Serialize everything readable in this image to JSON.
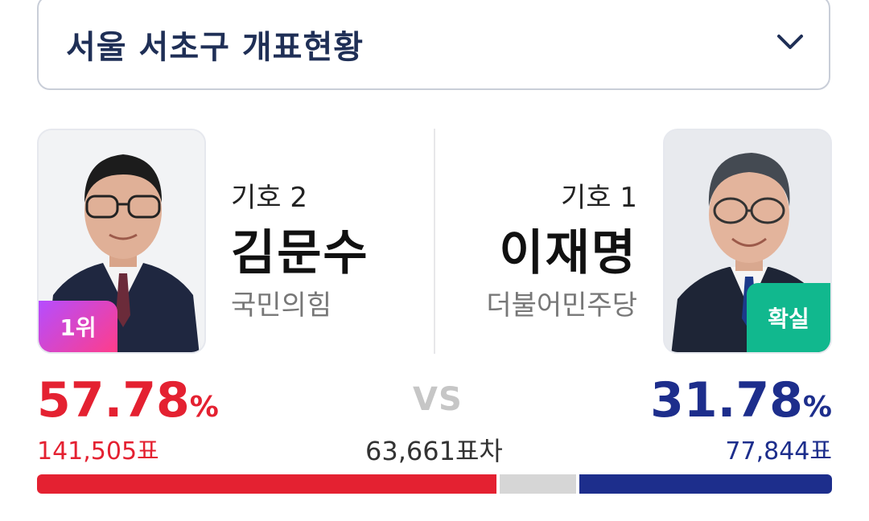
{
  "header": {
    "title": "서울 서초구 개표현황"
  },
  "candidates": {
    "left": {
      "number": "기호 2",
      "name": "김문수",
      "party": "국민의힘",
      "badge": "1위",
      "percent": "57.78",
      "percent_sign": "%",
      "votes": "141,505표",
      "share": 0.5778,
      "color": "#e42131"
    },
    "right": {
      "number": "기호 1",
      "name": "이재명",
      "party": "더불어민주당",
      "badge": "확실",
      "percent": "31.78",
      "percent_sign": "%",
      "votes": "77,844표",
      "share": 0.3178,
      "color": "#1d2e8c"
    }
  },
  "comparison": {
    "vs_label": "VS",
    "gap": "63,661표차"
  },
  "colors": {
    "header_text": "#1f2f56",
    "rank_badge_start": "#b54dff",
    "rank_badge_end": "#ff3d8a",
    "confirm_badge": "#11b88e",
    "bar_other": "#d6d6d6"
  },
  "icons": {
    "dropdown": "chevron-down-icon"
  }
}
